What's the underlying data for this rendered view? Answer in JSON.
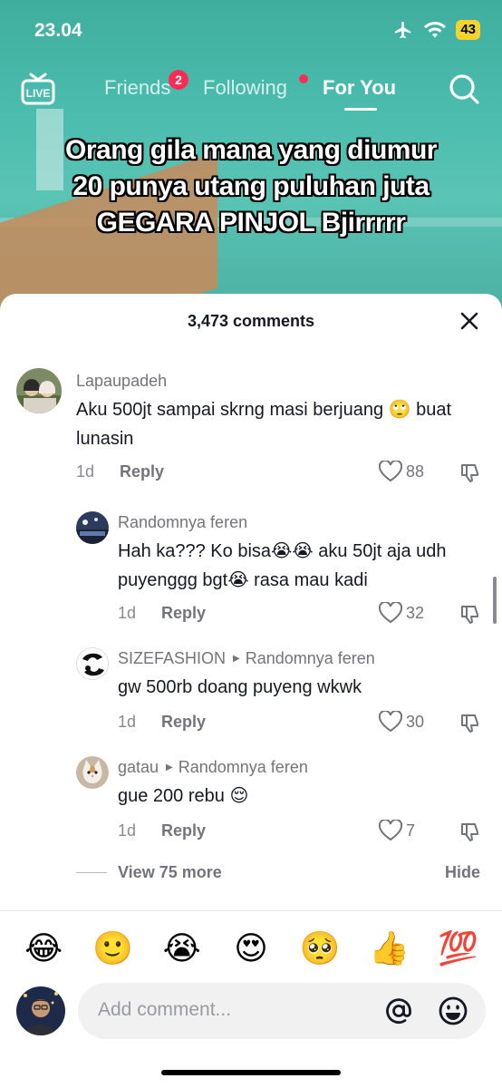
{
  "status_bar": {
    "time": "23.04",
    "battery": "43"
  },
  "nav": {
    "live_label": "LIVE",
    "tabs": [
      {
        "label": "Friends",
        "badge": "2"
      },
      {
        "label": "Following"
      },
      {
        "label": "For You",
        "active": true
      }
    ]
  },
  "video": {
    "caption": "Orang gila mana yang diumur 20 punya utang puluhan juta GEGARA PINJOL Bjirrrrr"
  },
  "comments_sheet": {
    "title": "3,473 comments",
    "comments": [
      {
        "username": "Lapaupadeh",
        "text": "Aku 500jt sampai skrng masi berjuang 🙄 buat lunasin",
        "time": "1d",
        "reply_label": "Reply",
        "likes": "88"
      },
      {
        "username": "Randomnya feren",
        "text": "Hah ka??? Ko bisa😭😭 aku 50jt aja udh puyenggg bgt😭 rasa mau kadi",
        "time": "1d",
        "reply_label": "Reply",
        "likes": "32"
      },
      {
        "username": "SIZEFASHION",
        "reply_to": "Randomnya feren",
        "text": "gw 500rb doang puyeng wkwk",
        "time": "1d",
        "reply_label": "Reply",
        "likes": "30"
      },
      {
        "username": "gatau",
        "reply_to": "Randomnya feren",
        "text": "gue 200 rebu 😌",
        "time": "1d",
        "reply_label": "Reply",
        "likes": "7"
      }
    ],
    "view_more": "View 75 more",
    "hide": "Hide",
    "quick_emojis": [
      "😂",
      "🙂",
      "😭",
      "😍",
      "🥺",
      "👍",
      "💯"
    ],
    "input_placeholder": "Add comment...",
    "colors": {
      "accent_red": "#fe2c55",
      "text_primary": "#161823",
      "text_secondary": "#73747b"
    }
  }
}
